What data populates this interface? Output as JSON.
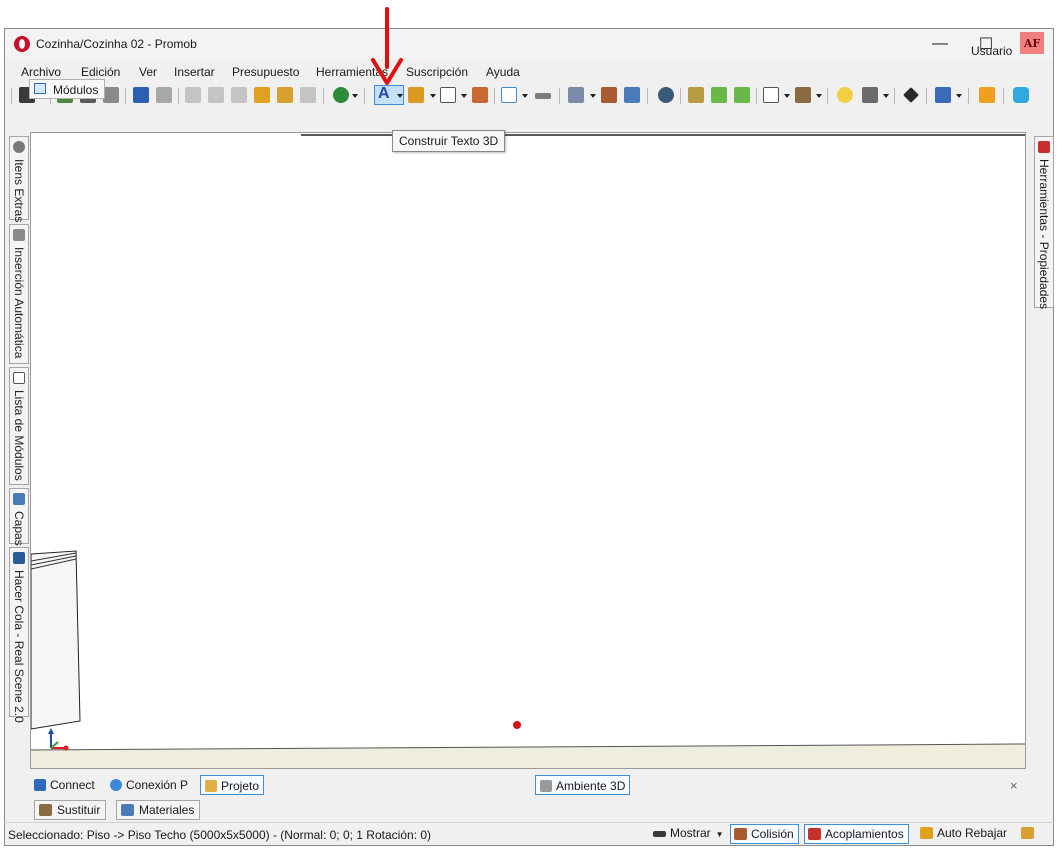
{
  "window": {
    "title": "Cozinha/Cozinha 02 - Promob",
    "minimize_glyph": "—",
    "maximize_glyph": "☐",
    "close_glyph": "✕"
  },
  "menu": {
    "items": [
      "Archivo",
      "Edición",
      "Ver",
      "Insertar",
      "Presupuesto",
      "Herramientas",
      "Suscripción",
      "Ayuda"
    ]
  },
  "user": {
    "label": "Usuario",
    "initials": "AF"
  },
  "toolbar": {
    "text3d_glyph": "A",
    "tooltip": "Construir Texto 3D"
  },
  "modules_tab": {
    "label": "Módulos"
  },
  "left_panels": [
    "Itens Extras",
    "Inserción Automática",
    "Lista de Módulos",
    "Capas",
    "Hacer Cola - Real Scene 2.0"
  ],
  "right_panels": [
    "Herramientas - Propiedades"
  ],
  "bottom_tabs": {
    "connect": "Connect",
    "conexion": "Conexión P",
    "projeto": "Projeto",
    "ambiente": "Ambiente 3D",
    "close_glyph": "×"
  },
  "panel_tabs": {
    "sustituir": "Sustituir",
    "materiales": "Materiales"
  },
  "status": {
    "selection": "Seleccionado: Piso -> Piso Techo (5000x5x5000) - (Normal: 0; 0; 1 Rotación: 0)",
    "mostrar": "Mostrar",
    "colision": "Colisión",
    "acoplamientos": "Acoplamientos",
    "auto_rebajar": "Auto Rebajar"
  },
  "colors": {
    "accent": "#3c8fd6",
    "annotation_arrow": "#e01010",
    "floor": "#efeede"
  }
}
